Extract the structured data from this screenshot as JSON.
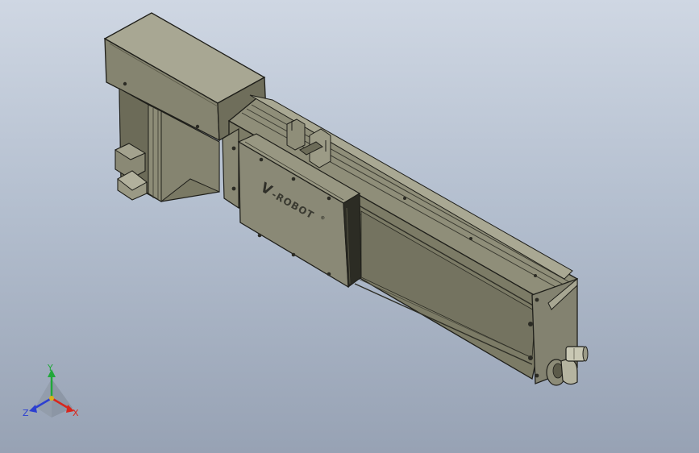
{
  "viewport": {
    "background_top": "#cfd7e3",
    "background_bottom": "#97a2b4"
  },
  "model": {
    "brand_logo_text": "-ROBOT",
    "brand_logo_mark": "V",
    "registered_mark": "®",
    "body_color": "#7e7d68",
    "edge_color": "#1f1f1a"
  },
  "triad": {
    "x_label": "X",
    "y_label": "Y",
    "z_label": "Z",
    "x_color": "#d8261c",
    "y_color": "#21a83a",
    "z_color": "#2c3fd1"
  }
}
